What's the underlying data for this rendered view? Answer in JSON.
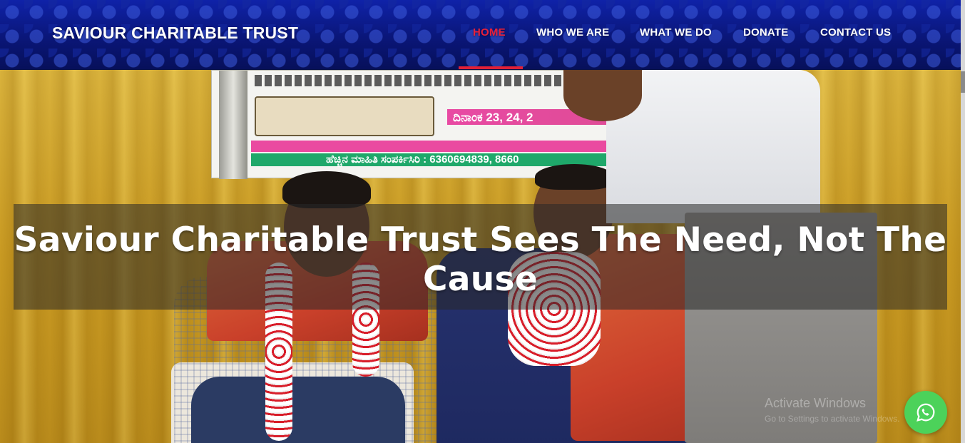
{
  "header": {
    "brand": "SAVIOUR CHARITABLE TRUST",
    "nav": [
      {
        "label": "HOME",
        "active": true
      },
      {
        "label": "WHO WE ARE",
        "active": false
      },
      {
        "label": "WHAT WE DO",
        "active": false
      },
      {
        "label": "DONATE",
        "active": false
      },
      {
        "label": "CONTACT US",
        "active": false
      }
    ],
    "active_color": "#e8203a"
  },
  "hero": {
    "headline": "Saviour Charitable Trust Sees The Need, Not The Cause",
    "banner_date": "ದಿನಾಂಕ 23, 24, 2",
    "banner_phone": "ಹೆಚ್ಚಿನ ಮಾಹಿತಿ ಸಂಪರ್ಕಿಸಿರಿ : 6360694839, 8660"
  },
  "watermark": {
    "title": "Activate Windows",
    "subtitle": "Go to Settings to activate Windows."
  },
  "whatsapp": {
    "icon": "whatsapp-icon",
    "color": "#4cd25a"
  }
}
